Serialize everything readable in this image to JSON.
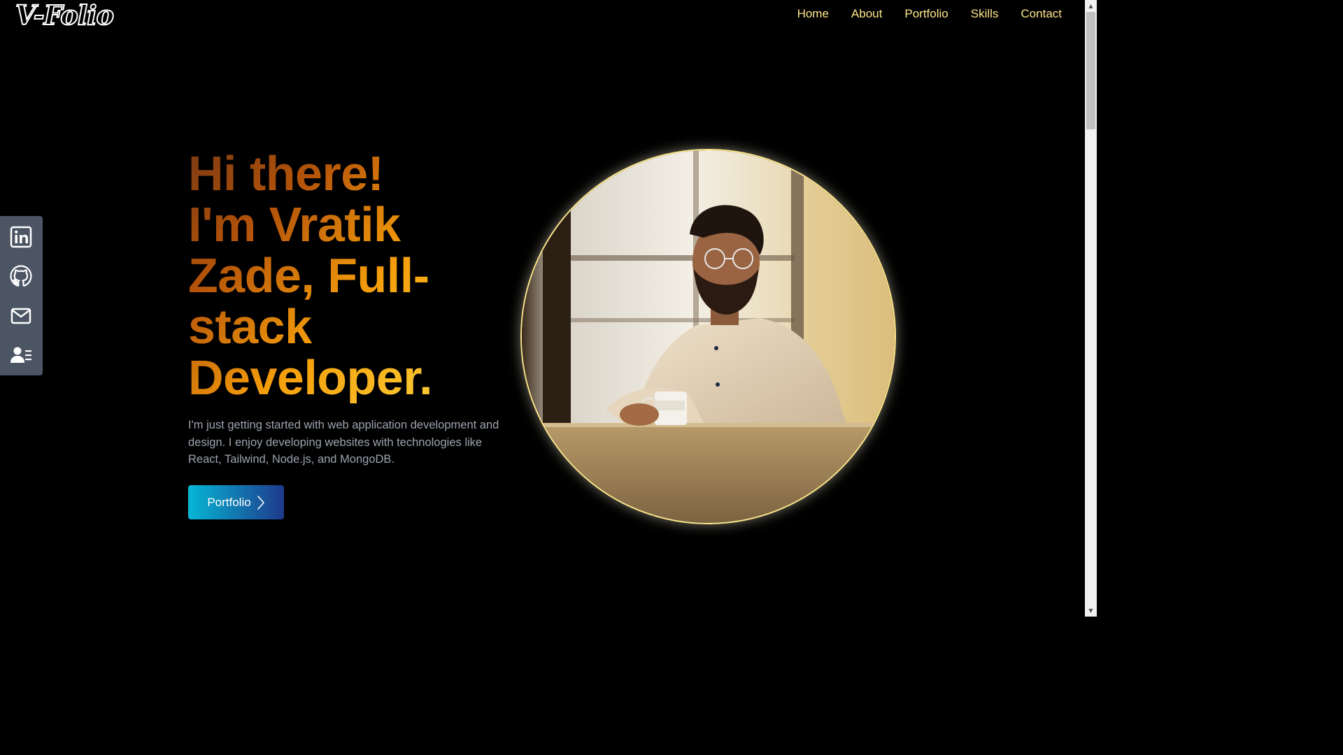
{
  "header": {
    "logo": "V-Folio",
    "nav": [
      "Home",
      "About",
      "Portfolio",
      "Skills",
      "Contact"
    ]
  },
  "social": [
    {
      "icon": "linkedin-icon"
    },
    {
      "icon": "github-icon"
    },
    {
      "icon": "mail-icon"
    },
    {
      "icon": "resume-icon"
    }
  ],
  "hero": {
    "title_lines": [
      "Hi there!",
      "I'm Vratik",
      "Zade, Full-",
      "stack",
      "Developer."
    ],
    "description": "I'm just getting started with web application development and design. I enjoy developing websites with technologies like React, Tailwind, Node.js, and MongoDB.",
    "button_label": "Portfolio",
    "button_icon": "chevron-right-icon",
    "photo_icon": "profile-photo"
  },
  "colors": {
    "background": "#000000",
    "nav_text": "#fde68a",
    "sidebar": "#4b5563",
    "button_gradient_start": "#06b6d4",
    "button_gradient_end": "#1e3a8a",
    "title_gradient": [
      "#7c3a12",
      "#b45309",
      "#f59e0b",
      "#fde047"
    ],
    "description": "#9ca3af",
    "photo_border": "#fde68a"
  }
}
